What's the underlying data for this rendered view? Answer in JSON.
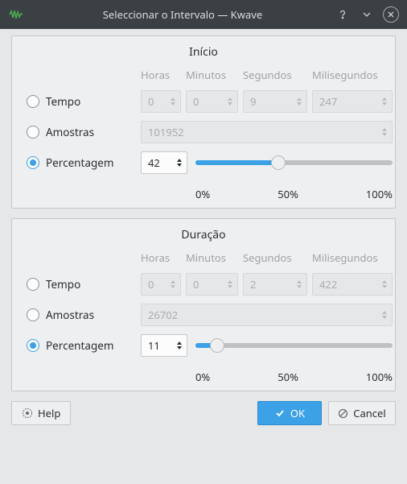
{
  "window": {
    "title": "Seleccionar o Intervalo — Kwave"
  },
  "columns": {
    "hours": "Horas",
    "minutes": "Minutos",
    "seconds": "Segundos",
    "milliseconds": "Milisegundos"
  },
  "options": {
    "time": "Tempo",
    "samples": "Amostras",
    "percentage": "Percentagem"
  },
  "start": {
    "title": "Início",
    "hours": "0",
    "minutes": "0",
    "seconds": "9",
    "milliseconds": "247",
    "samples": "101952",
    "percent": "42",
    "percent_num": 42
  },
  "duration": {
    "title": "Duração",
    "hours": "0",
    "minutes": "0",
    "seconds": "2",
    "milliseconds": "422",
    "samples": "26702",
    "percent": "11",
    "percent_num": 11
  },
  "ticks": {
    "t0": "0%",
    "t50": "50%",
    "t100": "100%"
  },
  "buttons": {
    "help": "Help",
    "ok": "OK",
    "cancel": "Cancel"
  }
}
